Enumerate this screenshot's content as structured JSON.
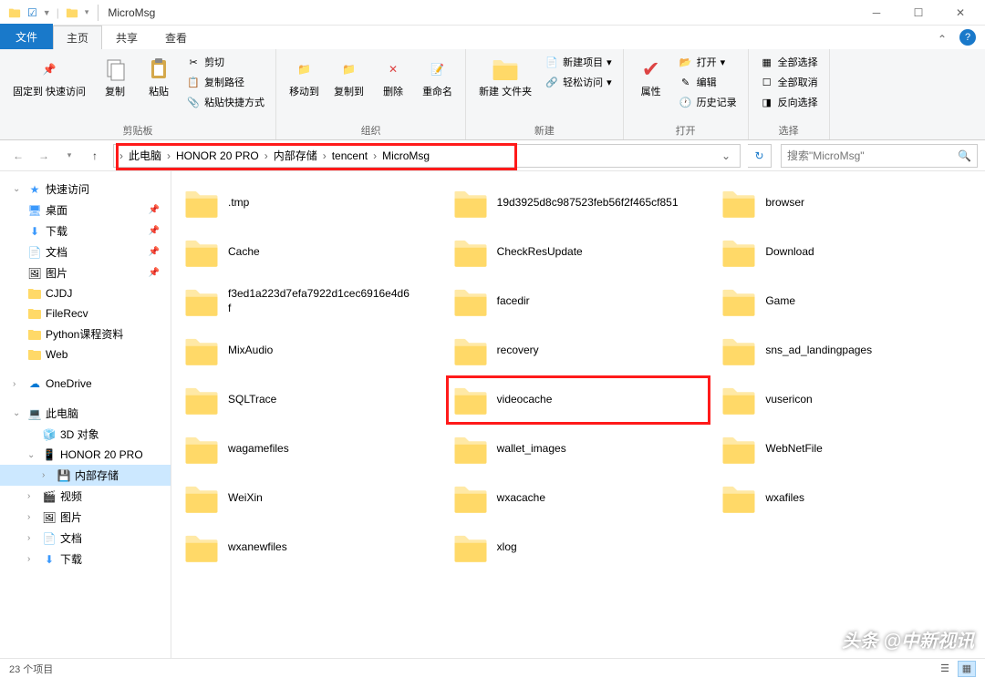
{
  "window": {
    "title": "MicroMsg",
    "qat_checked": true
  },
  "tabs": {
    "file": "文件",
    "home": "主页",
    "share": "共享",
    "view": "查看"
  },
  "ribbon": {
    "clipboard": {
      "label": "剪贴板",
      "pin": "固定到\n快速访问",
      "copy": "复制",
      "paste": "粘贴",
      "cut": "剪切",
      "copypath": "复制路径",
      "pasteshortcut": "粘贴快捷方式"
    },
    "organize": {
      "label": "组织",
      "moveto": "移动到",
      "copyto": "复制到",
      "delete": "删除",
      "rename": "重命名"
    },
    "new": {
      "label": "新建",
      "newfolder": "新建\n文件夹",
      "newitem": "新建项目",
      "easyaccess": "轻松访问"
    },
    "open": {
      "label": "打开",
      "properties": "属性",
      "open": "打开",
      "edit": "编辑",
      "history": "历史记录"
    },
    "select": {
      "label": "选择",
      "selectall": "全部选择",
      "selectnone": "全部取消",
      "invert": "反向选择"
    }
  },
  "breadcrumb": [
    "此电脑",
    "HONOR 20 PRO",
    "内部存储",
    "tencent",
    "MicroMsg"
  ],
  "search": {
    "placeholder": "搜索\"MicroMsg\""
  },
  "sidebar": {
    "quickaccess": "快速访问",
    "desktop": "桌面",
    "downloads": "下载",
    "documents": "文档",
    "pictures": "图片",
    "cjdj": "CJDJ",
    "filerecv": "FileRecv",
    "python": "Python课程资料",
    "web": "Web",
    "onedrive": "OneDrive",
    "thispc": "此电脑",
    "objects3d": "3D 对象",
    "honor": "HONOR 20 PRO",
    "internal": "内部存储",
    "videos": "视频",
    "pictures2": "图片",
    "documents2": "文档",
    "downloads2": "下载"
  },
  "folders": [
    {
      "name": ".tmp"
    },
    {
      "name": "19d3925d8c987523feb56f2f465cf851"
    },
    {
      "name": "browser"
    },
    {
      "name": "Cache"
    },
    {
      "name": "CheckResUpdate"
    },
    {
      "name": "Download"
    },
    {
      "name": "f3ed1a223d7efa7922d1cec6916e4d6f"
    },
    {
      "name": "facedir"
    },
    {
      "name": "Game"
    },
    {
      "name": "MixAudio"
    },
    {
      "name": "recovery"
    },
    {
      "name": "sns_ad_landingpages"
    },
    {
      "name": "SQLTrace"
    },
    {
      "name": "videocache",
      "highlight": true
    },
    {
      "name": "vusericon"
    },
    {
      "name": "wagamefiles"
    },
    {
      "name": "wallet_images"
    },
    {
      "name": "WebNetFile"
    },
    {
      "name": "WeiXin"
    },
    {
      "name": "wxacache"
    },
    {
      "name": "wxafiles"
    },
    {
      "name": "wxanewfiles"
    },
    {
      "name": "xlog"
    }
  ],
  "status": {
    "count": "23 个项目"
  },
  "watermark": "头条 @中新视讯"
}
